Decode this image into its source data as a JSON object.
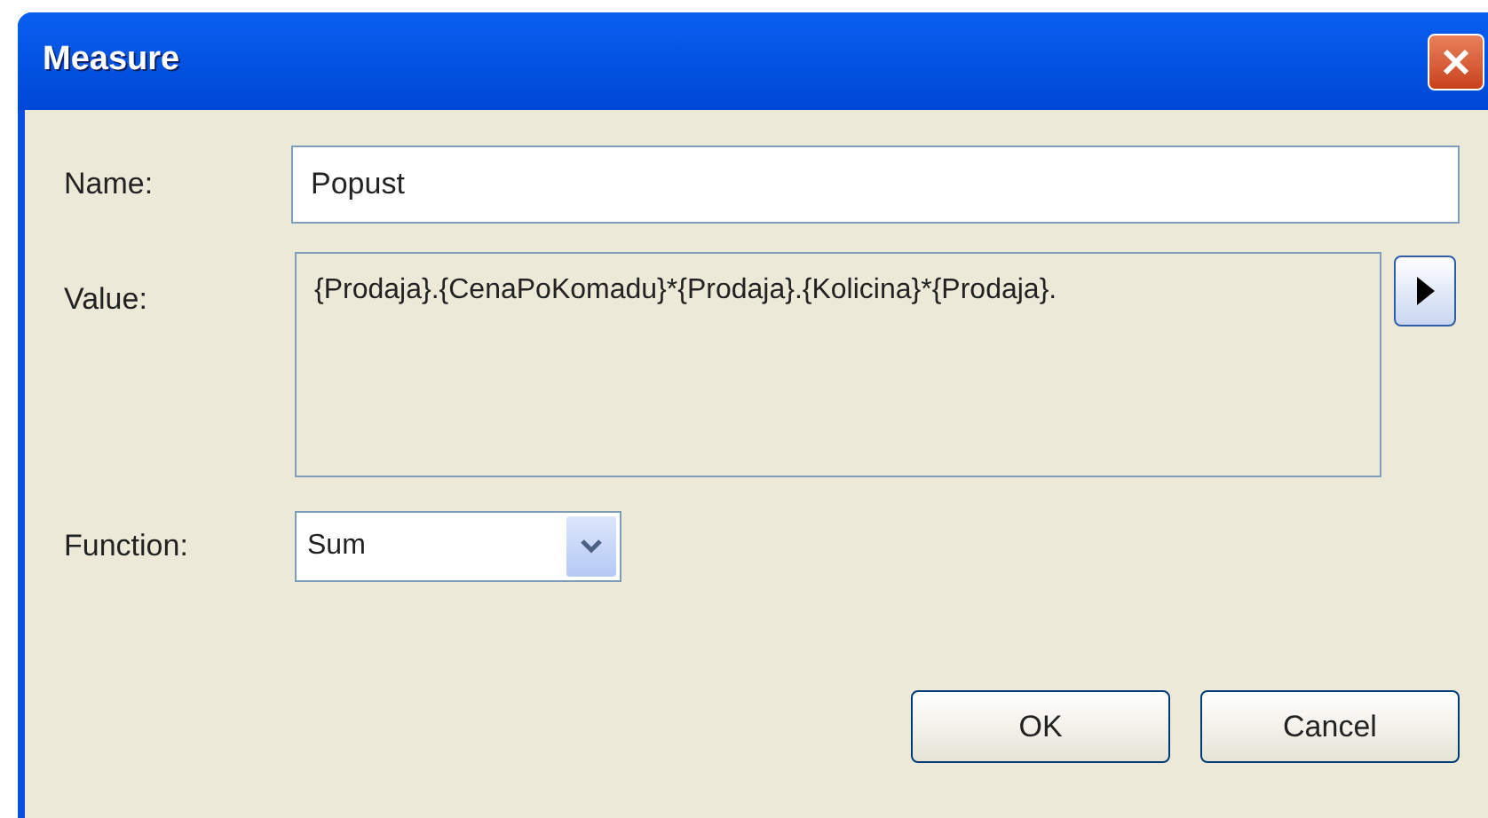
{
  "window": {
    "title": "Measure"
  },
  "fields": {
    "name": {
      "label": "Name:",
      "value": "Popust"
    },
    "value": {
      "label": "Value:",
      "value": "{Prodaja}.{CenaPoKomadu}*{Prodaja}.{Kolicina}*{Prodaja}."
    },
    "function": {
      "label": "Function:",
      "value": "Sum"
    }
  },
  "buttons": [
    "OK",
    "Cancel"
  ]
}
